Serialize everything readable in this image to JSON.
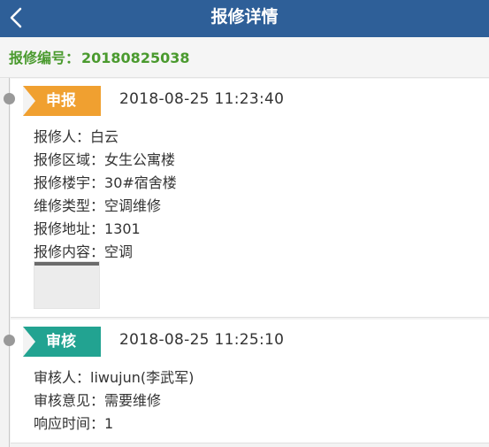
{
  "header": {
    "title": "报修详情",
    "back_icon": "chevron-left-icon",
    "bg_color": "#2e5f98"
  },
  "order": {
    "label": "报修编号：",
    "value": "20180825038",
    "color": "#4a9a2e"
  },
  "steps": [
    {
      "badge": "申报",
      "badge_color": "#f0a030",
      "time": "2018-08-25 11:23:40",
      "fields": [
        {
          "label": "报修人：",
          "value": "白云"
        },
        {
          "label": "报修区域：",
          "value": "女生公寓楼"
        },
        {
          "label": "报修楼宇：",
          "value": "30#宿舍楼"
        },
        {
          "label": "维修类型：",
          "value": "空调维修"
        },
        {
          "label": "报修地址：",
          "value": "1301"
        },
        {
          "label": "报修内容：",
          "value": "空调"
        }
      ]
    },
    {
      "badge": "审核",
      "badge_color": "#22a391",
      "time": "2018-08-25 11:25:10",
      "fields": [
        {
          "label": "审核人：",
          "value": "liwujun(李武军)"
        },
        {
          "label": "审核意见：",
          "value": "需要维修"
        },
        {
          "label": "响应时间：",
          "value": "1"
        }
      ]
    }
  ]
}
